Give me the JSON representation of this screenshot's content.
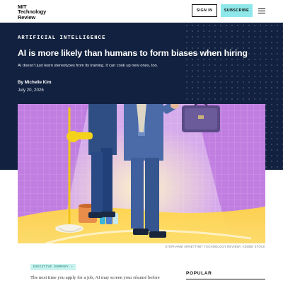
{
  "header": {
    "logo_line1": "MIT",
    "logo_line2": "Technology",
    "logo_line3": "Review",
    "signin_label": "SIGN IN",
    "subscribe_label": "SUBSCRIBE"
  },
  "article": {
    "section": "ARTIFICIAL INTELLIGENCE",
    "headline": "AI is more likely than humans to form biases when hiring",
    "dek": "AI doesn’t just learn stereotypes from its training. It can cook up new ones, too.",
    "byline": "By Michelle Kim",
    "date": "July 20, 2026",
    "image_credit": "STEPHANIE ARNETT/MIT TECHNOLOGY REVIEW | ADOBE STOCK"
  },
  "body": {
    "chip_label": "EXECUTIVE SUMMARY  —",
    "first_line": "The next time you apply for a job, AI may screen your résumé before"
  },
  "sidebar": {
    "popular_label": "POPULAR"
  },
  "colors": {
    "hero_bg": "#12213f",
    "subscribe_bg": "#8ee8ea",
    "image_bg": "#c07fe0"
  }
}
